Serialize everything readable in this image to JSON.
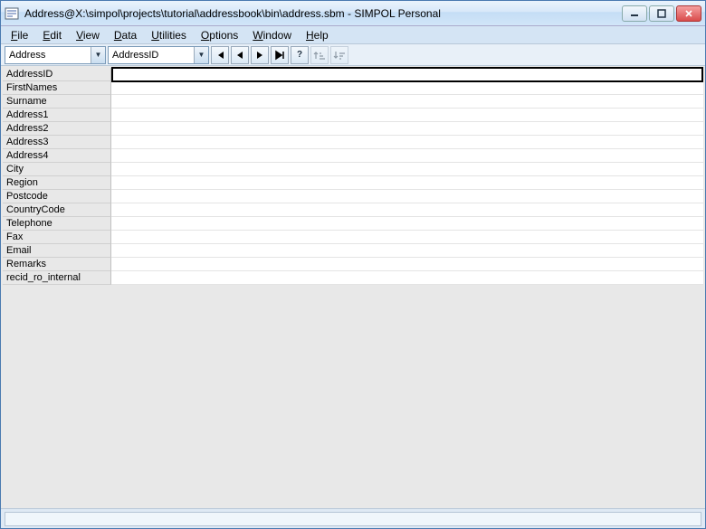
{
  "window": {
    "title": "Address@X:\\simpol\\projects\\tutorial\\addressbook\\bin\\address.sbm - SIMPOL Personal"
  },
  "menu": {
    "file": "File",
    "edit": "Edit",
    "view": "View",
    "data": "Data",
    "utilities": "Utilities",
    "options": "Options",
    "window": "Window",
    "help": "Help"
  },
  "toolbar": {
    "combo1": "Address",
    "combo2": "AddressID"
  },
  "fields": [
    {
      "label": "AddressID",
      "value": ""
    },
    {
      "label": "FirstNames",
      "value": ""
    },
    {
      "label": "Surname",
      "value": ""
    },
    {
      "label": "Address1",
      "value": ""
    },
    {
      "label": "Address2",
      "value": ""
    },
    {
      "label": "Address3",
      "value": ""
    },
    {
      "label": "Address4",
      "value": ""
    },
    {
      "label": "City",
      "value": ""
    },
    {
      "label": "Region",
      "value": ""
    },
    {
      "label": "Postcode",
      "value": ""
    },
    {
      "label": "CountryCode",
      "value": ""
    },
    {
      "label": "Telephone",
      "value": ""
    },
    {
      "label": "Fax",
      "value": ""
    },
    {
      "label": "Email",
      "value": ""
    },
    {
      "label": "Remarks",
      "value": ""
    },
    {
      "label": "recid_ro_internal",
      "value": ""
    }
  ],
  "statusbar": {
    "text": ""
  }
}
